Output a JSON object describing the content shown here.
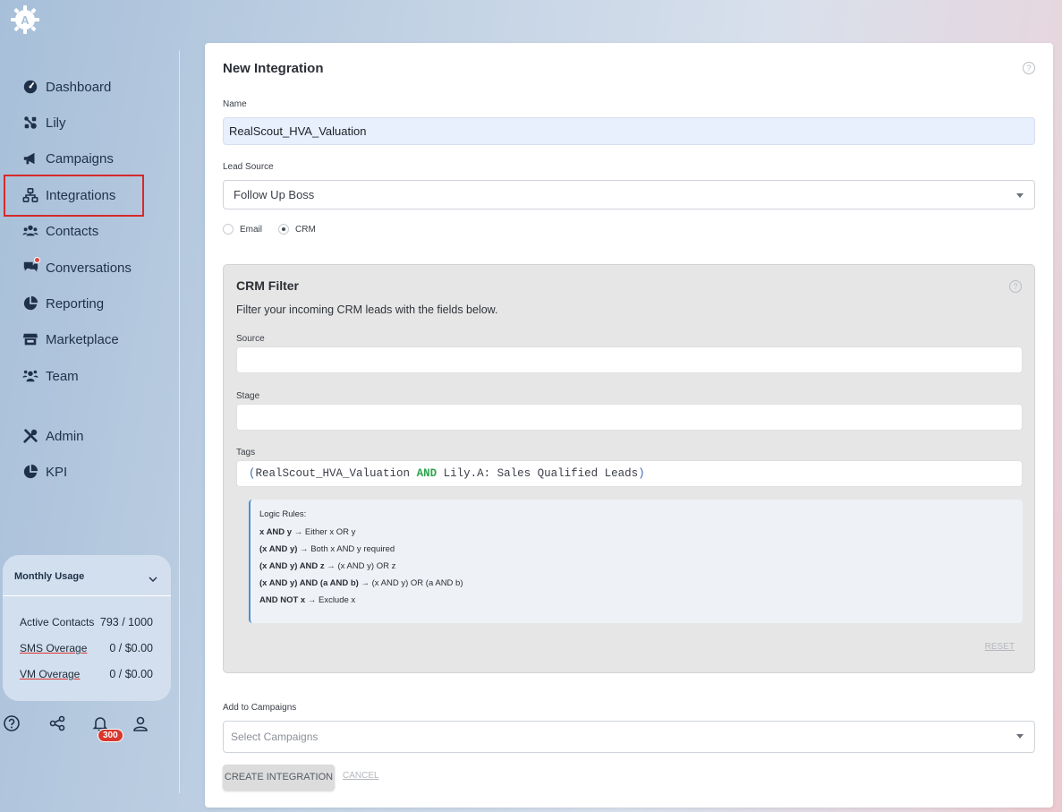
{
  "sidebar": {
    "nav": [
      {
        "label": "Dashboard",
        "icon": "gauge-icon"
      },
      {
        "label": "Lily",
        "icon": "robot-icon"
      },
      {
        "label": "Campaigns",
        "icon": "megaphone-icon"
      },
      {
        "label": "Integrations",
        "icon": "sitemap-icon"
      },
      {
        "label": "Contacts",
        "icon": "users-icon"
      },
      {
        "label": "Conversations",
        "icon": "chat-icon"
      },
      {
        "label": "Reporting",
        "icon": "pie-chart-icon"
      },
      {
        "label": "Marketplace",
        "icon": "store-icon"
      },
      {
        "label": "Team",
        "icon": "team-icon"
      },
      {
        "label": "Admin",
        "icon": "tools-icon"
      },
      {
        "label": "KPI",
        "icon": "pie-chart-icon"
      }
    ],
    "active": "Integrations",
    "usage": {
      "title": "Monthly Usage",
      "rows": [
        {
          "label": "Active Contacts",
          "value": "793 / 1000"
        },
        {
          "label": "SMS Overage",
          "value": "0 / $0.00"
        },
        {
          "label": "VM Overage",
          "value": "0 / $0.00"
        }
      ]
    },
    "notification_count": "300"
  },
  "form": {
    "title": "New Integration",
    "name_label": "Name",
    "name_value": "RealScout_HVA_Valuation",
    "lead_source_label": "Lead Source",
    "lead_source_value": "Follow Up Boss",
    "radio_email": "Email",
    "radio_crm": "CRM",
    "radio_selected": "CRM",
    "crm_filter": {
      "title": "CRM Filter",
      "description": "Filter your incoming CRM leads with the fields below.",
      "source_label": "Source",
      "source_value": "",
      "stage_label": "Stage",
      "stage_value": "",
      "tags_label": "Tags",
      "tags_value": {
        "open": "(",
        "term1": "RealScout_HVA_Valuation",
        "op": "AND",
        "term2": "Lily.A: Sales Qualified Leads",
        "close": ")"
      },
      "logic_rules": {
        "heading": "Logic Rules:",
        "rules": [
          {
            "expr": "x AND y →",
            "desc": "Either x OR y"
          },
          {
            "expr": "(x AND y) →",
            "desc": "Both x AND y required"
          },
          {
            "expr": "(x AND y) AND z →",
            "desc": "(x AND y) OR z"
          },
          {
            "expr": "(x AND y) AND (a AND b) →",
            "desc": "(x AND y) OR (a AND b)"
          },
          {
            "expr": "AND NOT x →",
            "desc": "Exclude x"
          }
        ]
      },
      "reset_label": "RESET"
    },
    "campaigns_label": "Add to Campaigns",
    "campaigns_placeholder": "Select Campaigns",
    "create_label": "CREATE INTEGRATION",
    "cancel_label": "CANCEL"
  },
  "colors": {
    "highlight": "#d42a2a",
    "tag_keyword": "#2ea44f",
    "rules_border": "#4d8fd1",
    "badge": "#d9362c"
  }
}
